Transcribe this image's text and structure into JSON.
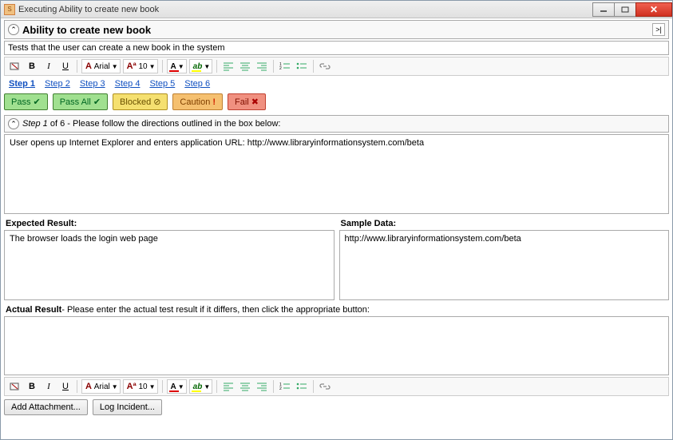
{
  "window": {
    "title": "Executing Ability to create new book"
  },
  "header": {
    "title": "Ability to create new book"
  },
  "description": "Tests that the user can create a new book in the system",
  "toolbar": {
    "font_name": "Arial",
    "font_size": "10"
  },
  "steps": [
    {
      "label": "Step  1"
    },
    {
      "label": "Step  2"
    },
    {
      "label": "Step  3"
    },
    {
      "label": "Step  4"
    },
    {
      "label": "Step  5"
    },
    {
      "label": "Step  6"
    }
  ],
  "status_buttons": {
    "pass": "Pass",
    "pass_all": "Pass All",
    "blocked": "Blocked",
    "caution": "Caution",
    "fail": "Fail"
  },
  "step_header": {
    "step_part": "Step 1",
    "of_part": " of 6 - Please follow the directions outlined in the box below:"
  },
  "step_instruction": "User opens up Internet Explorer and enters application URL: http://www.libraryinformationsystem.com/beta",
  "expected": {
    "label": "Expected Result:",
    "text": "The browser loads the login web page"
  },
  "sample": {
    "label": "Sample Data:",
    "text": "http://www.libraryinformationsystem.com/beta"
  },
  "actual": {
    "label_bold": "Actual Result",
    "label_rest": "- Please enter the actual test result if it differs, then click the appropriate button:"
  },
  "buttons": {
    "add_attachment": "Add Attachment...",
    "log_incident": "Log Incident..."
  }
}
